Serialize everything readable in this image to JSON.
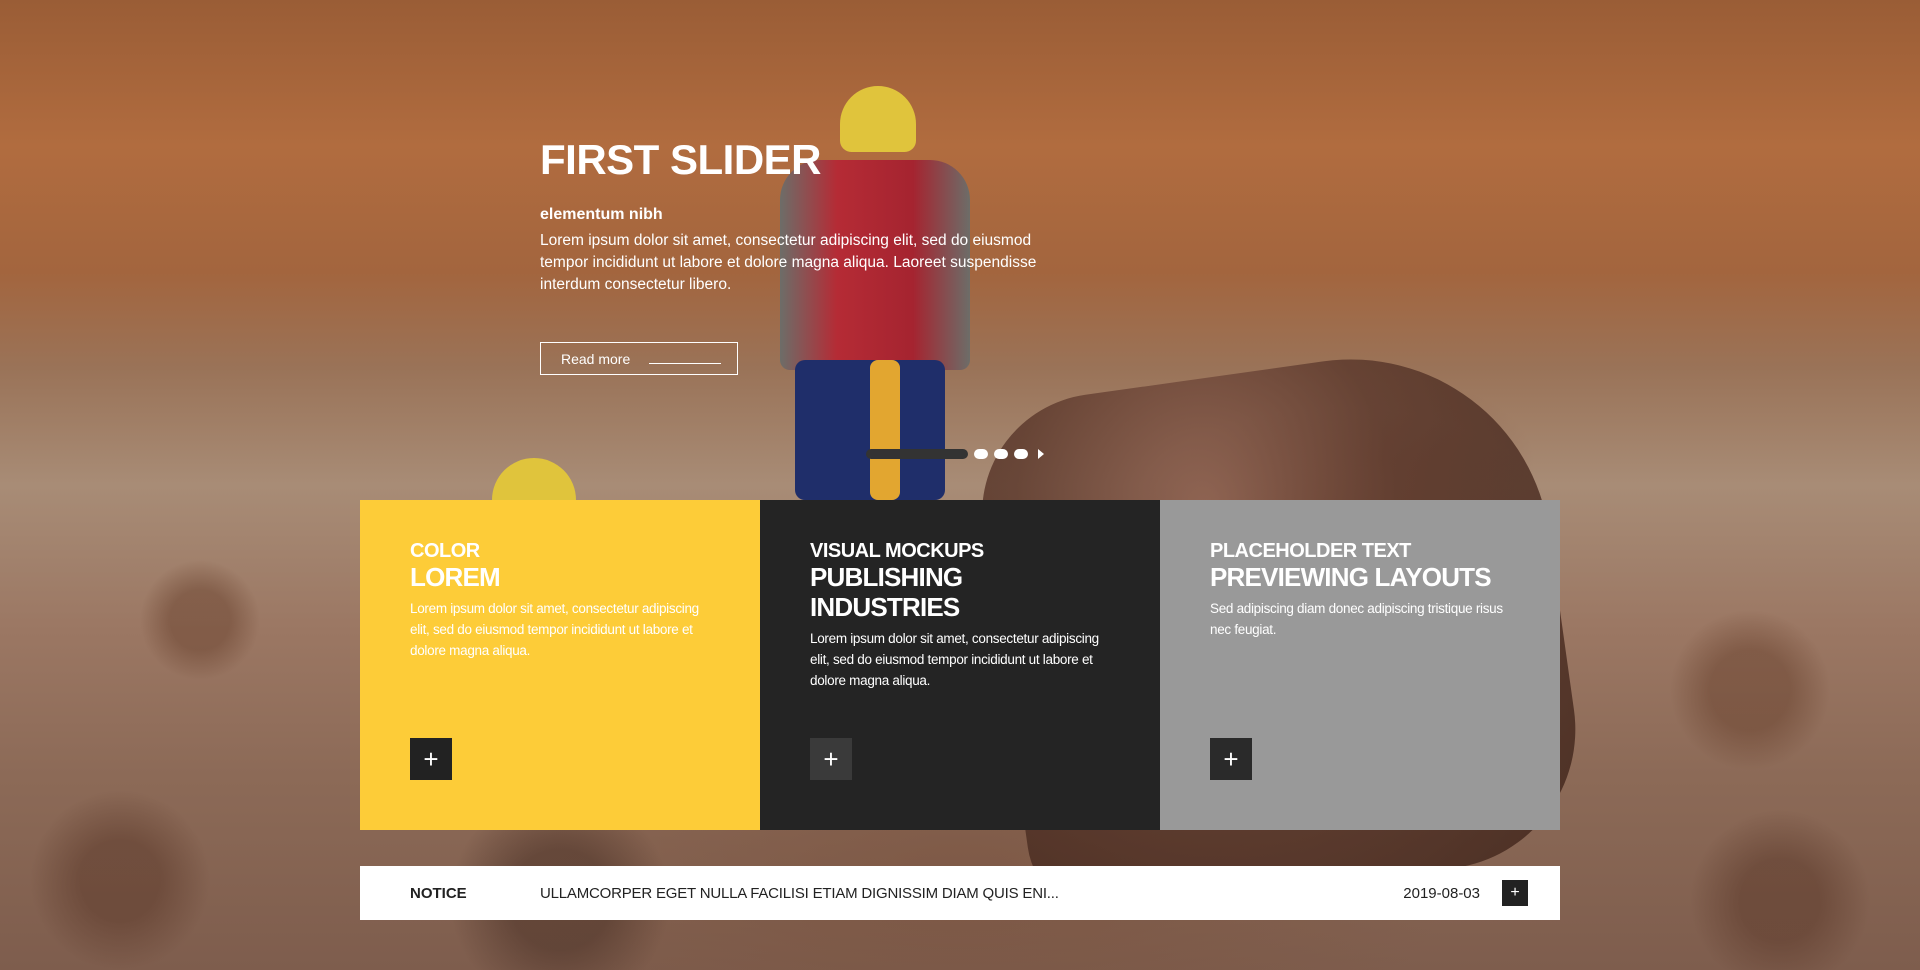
{
  "slider": {
    "title": "FIRST SLIDER",
    "subtitle": "elementum nibh",
    "text": "Lorem ipsum dolor sit amet, consectetur adipiscing elit, sed do eiusmod tempor incididunt ut labore et dolore magna aliqua. Laoreet suspendisse interdum consectetur libero.",
    "read_more": "Read more",
    "pager_dots": 3,
    "active_slide": 1
  },
  "boxes": [
    {
      "kicker": "COLOR",
      "title": "LOREM",
      "text": "Lorem ipsum dolor sit amet, consectetur adipiscing elit, sed do eiusmod tempor incididunt ut labore et dolore magna aliqua.",
      "button": "+",
      "color": "#fdcc38"
    },
    {
      "kicker": "VISUAL MOCKUPS",
      "title": "PUBLISHING INDUSTRIES",
      "text": "Lorem ipsum dolor sit amet, consectetur adipiscing elit, sed do eiusmod tempor incididunt ut labore et dolore magna aliqua.",
      "button": "+",
      "color": "#242424"
    },
    {
      "kicker": "PLACEHOLDER TEXT",
      "title": "PREVIEWING LAYOUTS",
      "text": "Sed adipiscing diam donec adipiscing tristique risus nec feugiat.",
      "button": "+",
      "color": "#999999"
    }
  ],
  "notice": {
    "label": "NOTICE",
    "text": "ULLAMCORPER EGET NULLA FACILISI ETIAM DIGNISSIM DIAM QUIS ENI...",
    "date": "2019-08-03",
    "button": "+"
  }
}
